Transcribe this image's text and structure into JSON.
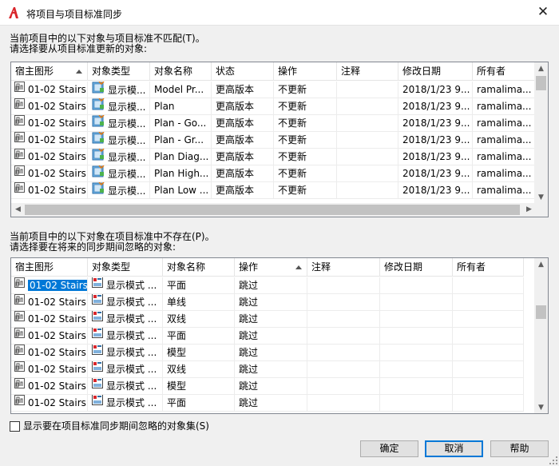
{
  "window": {
    "title": "将项目与项目标准同步",
    "close_glyph": "✕"
  },
  "section1": {
    "label_line1": "当前项目中的以下对象与项目标准不匹配(T)。",
    "label_line2": "请选择要从项目标准更新的对象:",
    "columns": [
      "宿主图形",
      "对象类型",
      "对象名称",
      "状态",
      "操作",
      "注释",
      "修改日期",
      "所有者"
    ],
    "sort_column": "宿主图形",
    "rows": [
      [
        "01-02 Stairs",
        "显示模...",
        "Model Pr...",
        "更高版本",
        "不更新",
        "",
        "2018/1/23 9...",
        "ramalima..."
      ],
      [
        "01-02 Stairs",
        "显示模...",
        "Plan",
        "更高版本",
        "不更新",
        "",
        "2018/1/23 9...",
        "ramalima..."
      ],
      [
        "01-02 Stairs",
        "显示模...",
        "Plan - Go...",
        "更高版本",
        "不更新",
        "",
        "2018/1/23 9...",
        "ramalima..."
      ],
      [
        "01-02 Stairs",
        "显示模...",
        "Plan - Gr...",
        "更高版本",
        "不更新",
        "",
        "2018/1/23 9...",
        "ramalima..."
      ],
      [
        "01-02 Stairs",
        "显示模...",
        "Plan Diag...",
        "更高版本",
        "不更新",
        "",
        "2018/1/23 9...",
        "ramalima..."
      ],
      [
        "01-02 Stairs",
        "显示模...",
        "Plan High...",
        "更高版本",
        "不更新",
        "",
        "2018/1/23 9...",
        "ramalima..."
      ],
      [
        "01-02 Stairs",
        "显示模...",
        "Plan Low ...",
        "更高版本",
        "不更新",
        "",
        "2018/1/23 9...",
        "ramalima..."
      ]
    ]
  },
  "section2": {
    "label_line1": "当前项目中的以下对象在项目标准中不存在(P)。",
    "label_line2": "请选择要在将来的同步期间忽略的对象:",
    "columns": [
      "宿主图形",
      "对象类型",
      "对象名称",
      "操作",
      "注释",
      "修改日期",
      "所有者"
    ],
    "sort_column": "操作",
    "rows": [
      [
        "01-02 Stairs",
        "显示模式 ...",
        "平面",
        "跳过",
        "",
        "",
        ""
      ],
      [
        "01-02 Stairs",
        "显示模式 ...",
        "单线",
        "跳过",
        "",
        "",
        ""
      ],
      [
        "01-02 Stairs",
        "显示模式 ...",
        "双线",
        "跳过",
        "",
        "",
        ""
      ],
      [
        "01-02 Stairs",
        "显示模式 ...",
        "平面",
        "跳过",
        "",
        "",
        ""
      ],
      [
        "01-02 Stairs",
        "显示模式 ...",
        "模型",
        "跳过",
        "",
        "",
        ""
      ],
      [
        "01-02 Stairs",
        "显示模式 ...",
        "双线",
        "跳过",
        "",
        "",
        ""
      ],
      [
        "01-02 Stairs",
        "显示模式 ...",
        "模型",
        "跳过",
        "",
        "",
        ""
      ],
      [
        "01-02 Stairs",
        "显示模式 ...",
        "平面",
        "跳过",
        "",
        "",
        ""
      ]
    ]
  },
  "checkbox": {
    "label": "显示要在项目标准同步期间忽略的对象集(S)",
    "checked": false
  },
  "buttons": {
    "ok": "确定",
    "cancel": "取消",
    "help": "帮助"
  },
  "colors": {
    "selection": "#0078d7",
    "accent_red": "#d9262b"
  }
}
